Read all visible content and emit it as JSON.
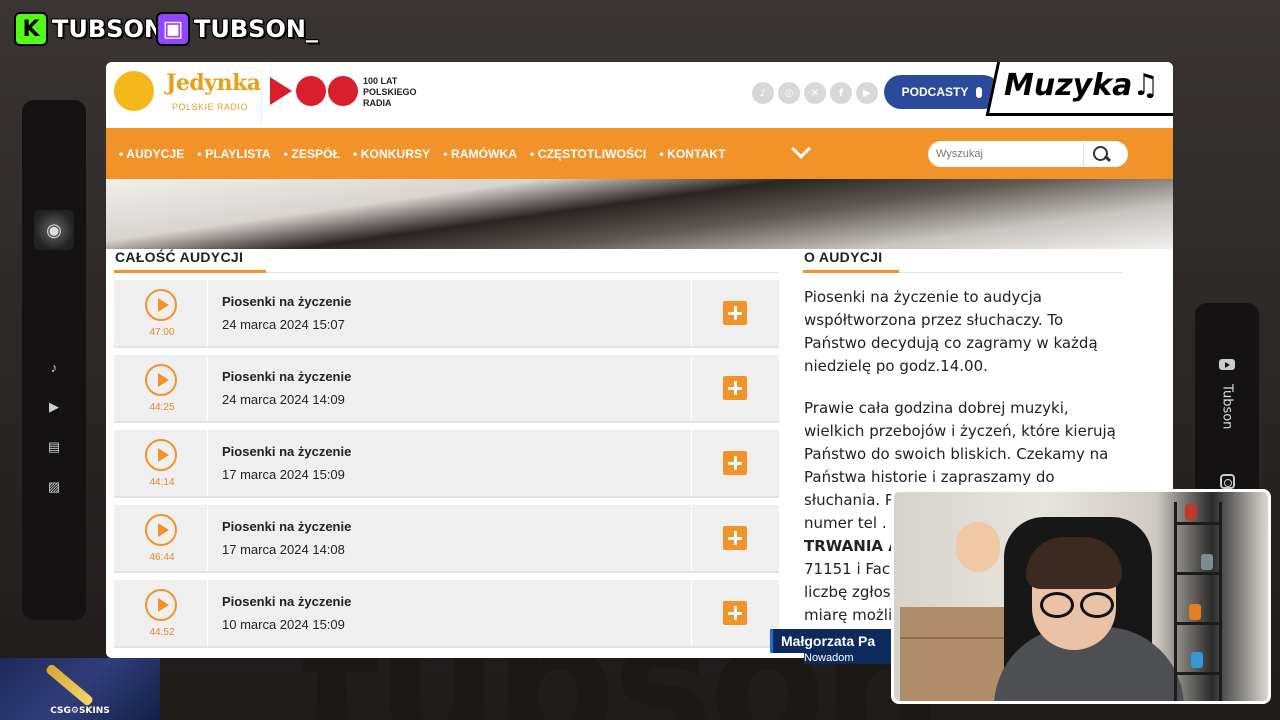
{
  "overlay": {
    "kick_handle": "TUBSON",
    "twitch_handle": "TUBSON_",
    "right_bar_name": "Tubson",
    "skins_label": "CSG⚙SKINS",
    "background_text": "tubson"
  },
  "site": {
    "logo_title": "Jedynka",
    "logo_subtitle": "POLSKIE RADIO",
    "centenary_text": "100 LAT POLSKIEGO RADIA",
    "socials": [
      "tiktok-icon",
      "instagram-icon",
      "x-icon",
      "facebook-icon",
      "youtube-icon"
    ],
    "podcasty_label": "PODCASTY",
    "muzyka_label": "Muzyka♫",
    "accent_color": "#f2932a",
    "nav": [
      "AUDYCJE",
      "PLAYLISTA",
      "ZESPÓŁ",
      "KONKURSY",
      "RAMÓWKA",
      "CZĘSTOTLIWOŚCI",
      "KONTAKT"
    ],
    "search_placeholder": "Wyszukaj"
  },
  "episodes": {
    "section_title": "CAŁOŚĆ AUDYCJI",
    "items": [
      {
        "title": "Piosenki na życzenie",
        "date": "24 marca 2024 15:07",
        "duration": "47:00"
      },
      {
        "title": "Piosenki na życzenie",
        "date": "24 marca 2024 14:09",
        "duration": "44:25"
      },
      {
        "title": "Piosenki na życzenie",
        "date": "17 marca 2024 15:09",
        "duration": "44:14"
      },
      {
        "title": "Piosenki na życzenie",
        "date": "17 marca 2024 14:08",
        "duration": "46:44"
      },
      {
        "title": "Piosenki na życzenie",
        "date": "10 marca 2024 15:09",
        "duration": "44:52"
      }
    ]
  },
  "about": {
    "section_title": "O AUDYCJI",
    "para1": "Piosenki na życzenie to audycja współtworzona przez słuchaczy. To Państwo decydują co zagramy w każdą niedzielę po godz.14.00.",
    "para2_l1": "Prawie cała godzina dobrej muzyki,",
    "para2_l2": "wielkich przebojów i życzeń, które kierują",
    "para2_l3": "Państwo do swoich bliskich. Czekamy na",
    "para2_l4": "Państwa historie i zapraszamy do",
    "para2_l5": "słuchania. P",
    "para2_l6": "numer tel . :",
    "para2_l7": "TRWANIA AU",
    "para2_l8": "71151 i Faceb",
    "para2_l9": "liczbę zgłos",
    "para2_l10": "miarę możli"
  },
  "lower_third": {
    "name": "Małgorzata Pa",
    "sub": "Nowadom"
  }
}
